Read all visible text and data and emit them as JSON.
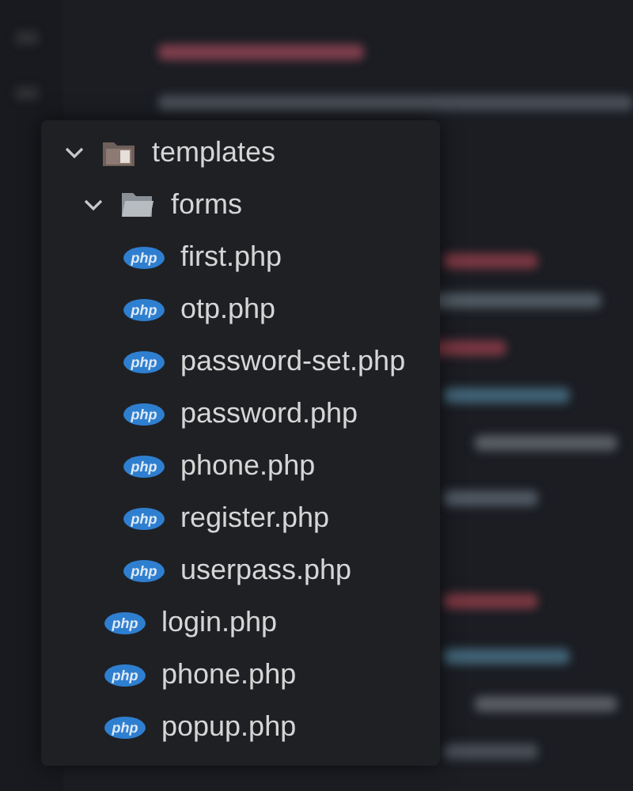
{
  "tree": [
    {
      "kind": "special-folder",
      "name": "templates",
      "expanded": true,
      "children": [
        {
          "kind": "folder",
          "name": "forms",
          "expanded": true,
          "children": [
            {
              "kind": "file",
              "name": "first.php",
              "icon_text": "php"
            },
            {
              "kind": "file",
              "name": "otp.php",
              "icon_text": "php"
            },
            {
              "kind": "file",
              "name": "password-set.php",
              "icon_text": "php"
            },
            {
              "kind": "file",
              "name": "password.php",
              "icon_text": "php"
            },
            {
              "kind": "file",
              "name": "phone.php",
              "icon_text": "php"
            },
            {
              "kind": "file",
              "name": "register.php",
              "icon_text": "php"
            },
            {
              "kind": "file",
              "name": "userpass.php",
              "icon_text": "php"
            }
          ]
        },
        {
          "kind": "file",
          "name": "login.php",
          "icon_text": "php"
        },
        {
          "kind": "file",
          "name": "phone.php",
          "icon_text": "php"
        },
        {
          "kind": "file",
          "name": "popup.php",
          "icon_text": "php"
        }
      ]
    }
  ]
}
